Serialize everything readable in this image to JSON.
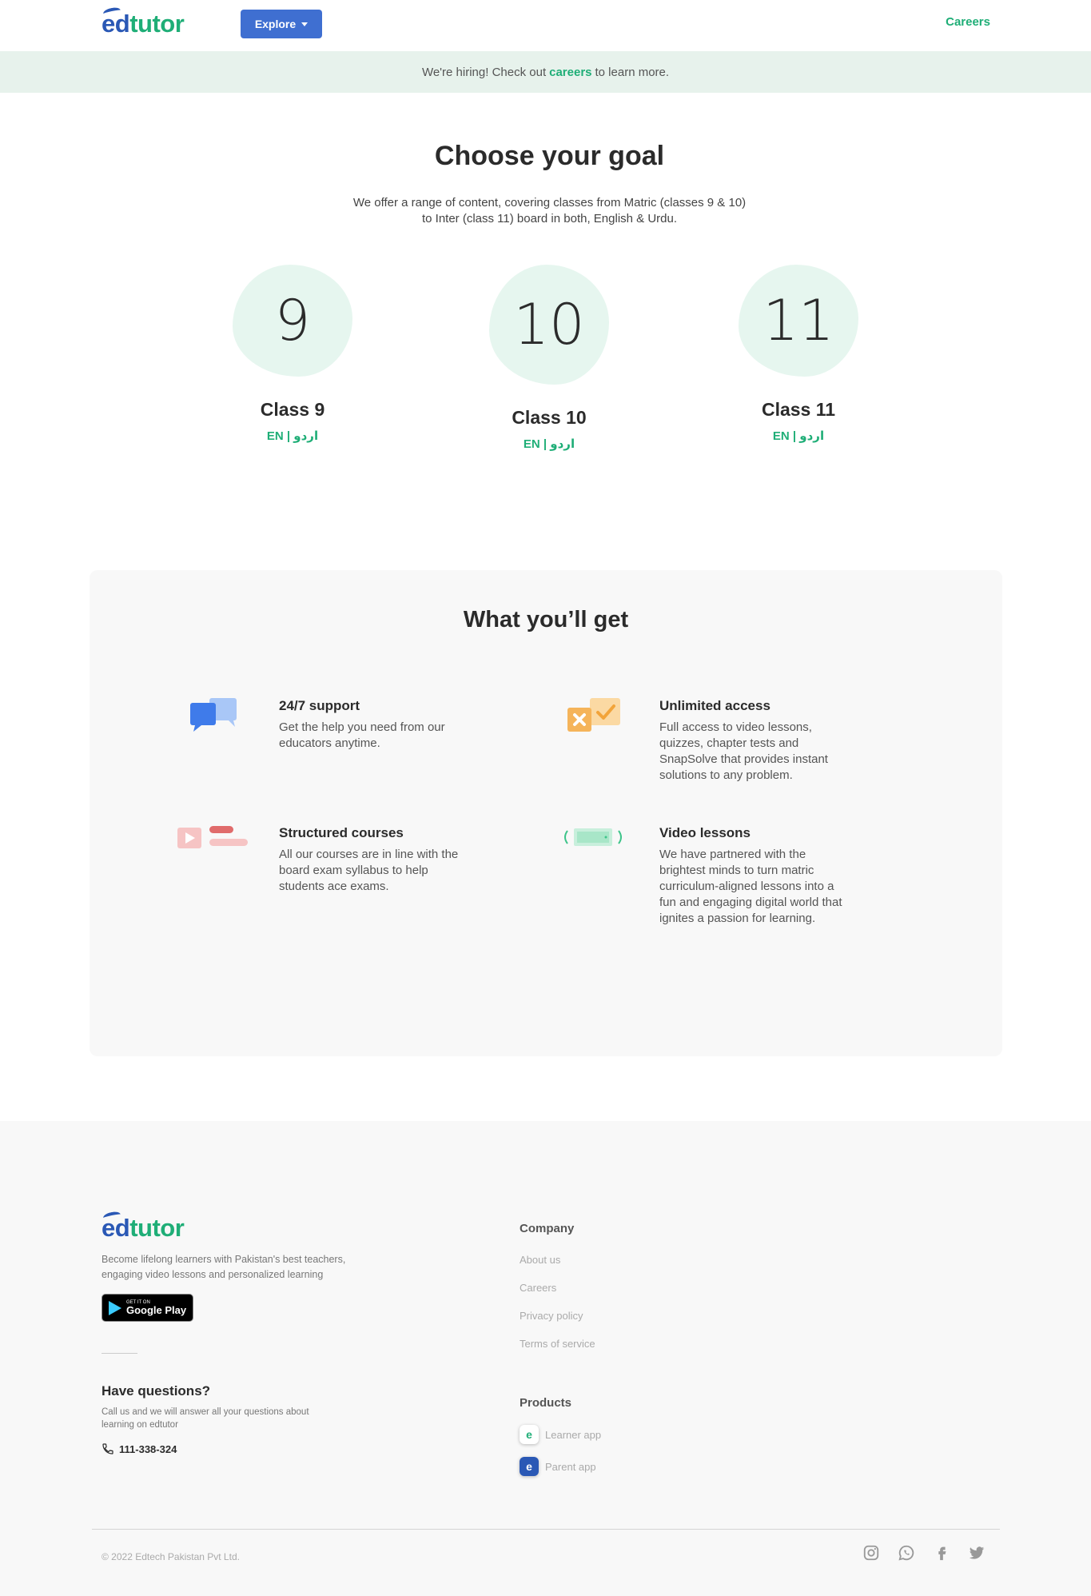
{
  "header": {
    "logo": {
      "part1": "ed",
      "part2": "tutor"
    },
    "explore_label": "Explore",
    "careers_label": "Careers"
  },
  "banner": {
    "before": "We're hiring! Check out",
    "link": "careers",
    "after": "to learn more."
  },
  "goal": {
    "title": "Choose your goal",
    "subtitle": "We offer a range of content, covering classes from Matric (classes 9 & 10) to Inter (class 11) board in both, English & Urdu.",
    "classes": [
      {
        "glyph": "9",
        "name": "Class 9",
        "lang_en": "EN",
        "sep": "|",
        "lang_ur": "اردو"
      },
      {
        "glyph": "10",
        "name": "Class 10",
        "lang_en": "EN",
        "sep": "|",
        "lang_ur": "اردو"
      },
      {
        "glyph": "11",
        "name": "Class 11",
        "lang_en": "EN",
        "sep": "|",
        "lang_ur": "اردو"
      }
    ]
  },
  "features": {
    "title": "What you’ll get",
    "items": [
      {
        "icon": "chat-bubbles-icon",
        "title": "24/7 support",
        "text": "Get the help you need from our educators anytime."
      },
      {
        "icon": "quiz-check-icon",
        "title": "Unlimited access",
        "text": "Full access to video lessons, quizzes, chapter tests and SnapSolve that provides instant solutions to any problem."
      },
      {
        "icon": "course-play-icon",
        "title": "Structured courses",
        "text": "All our courses are in line with the board exam syllabus to help students ace exams."
      },
      {
        "icon": "video-screen-icon",
        "title": "Video lessons",
        "text": "We have partnered with the brightest minds to turn matric curriculum-aligned lessons into a fun and engaging digital world that ignites a passion for learning."
      }
    ]
  },
  "footer": {
    "tagline": "Become lifelong learners with Pakistan's best teachers, engaging video lessons and personalized learning",
    "gplay": {
      "small": "GET IT ON",
      "big": "Google Play"
    },
    "questions_title": "Have questions?",
    "questions_sub": "Call us and we will answer all your questions about learning on edtutor",
    "phone": "111-338-324",
    "company_title": "Company",
    "company_links": [
      "About us",
      "Careers",
      "Privacy policy",
      "Terms of service"
    ],
    "products_title": "Products",
    "products": [
      {
        "icon": "learner-app-icon",
        "label": "Learner app"
      },
      {
        "icon": "parent-app-icon",
        "label": "Parent app"
      }
    ],
    "copyright": "© 2022 Edtech Pakistan Pvt Ltd.",
    "socials": [
      "instagram-icon",
      "whatsapp-icon",
      "facebook-icon",
      "twitter-icon"
    ]
  }
}
